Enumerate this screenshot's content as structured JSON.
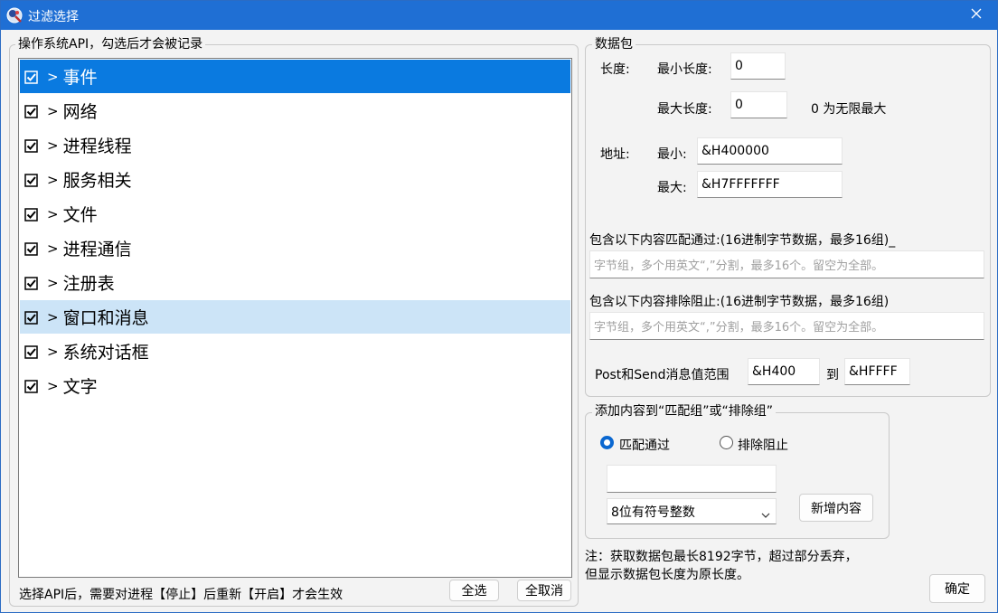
{
  "window": {
    "title": "过滤选择",
    "close_glyph": "✕"
  },
  "api_group": {
    "legend": "操作系统API，勾选后才会被记录",
    "items": [
      {
        "label": "事件",
        "checked": true,
        "state": "selected"
      },
      {
        "label": "网络",
        "checked": true,
        "state": "normal"
      },
      {
        "label": "进程线程",
        "checked": true,
        "state": "normal"
      },
      {
        "label": "服务相关",
        "checked": true,
        "state": "normal"
      },
      {
        "label": "文件",
        "checked": true,
        "state": "normal"
      },
      {
        "label": "进程通信",
        "checked": true,
        "state": "normal"
      },
      {
        "label": "注册表",
        "checked": true,
        "state": "normal"
      },
      {
        "label": "窗口和消息",
        "checked": true,
        "state": "hovered"
      },
      {
        "label": "系统对话框",
        "checked": true,
        "state": "normal"
      },
      {
        "label": "文字",
        "checked": true,
        "state": "normal"
      }
    ],
    "hint": "选择API后，需要对进程【停止】后重新【开启】才会生效",
    "select_all_label": "全选",
    "deselect_all_label": "全取消"
  },
  "packet_group": {
    "legend": "数据包",
    "length_label": "长度:",
    "min_length_label": "最小长度:",
    "min_length_value": "0",
    "max_length_label": "最大长度:",
    "max_length_value": "0",
    "max_length_note": "0 为无限最大",
    "address_label": "地址:",
    "min_addr_label": "最小:",
    "min_addr_value": "&H400000",
    "max_addr_label": "最大:",
    "max_addr_value": "&H7FFFFFFF",
    "include_label": "包含以下内容匹配通过:(16进制字节数据，最多16组)_",
    "include_placeholder": "字节组，多个用英文“,”分割，最多16个。留空为全部。",
    "exclude_label": "包含以下内容排除阻止:(16进制字节数据，最多16组)",
    "exclude_placeholder": "字节组，多个用英文“,”分割，最多16个。留空为全部。",
    "msg_range_label": "Post和Send消息值范围",
    "msg_from_value": "&H400",
    "msg_to_label": "到",
    "msg_to_value": "&HFFFF"
  },
  "add_group": {
    "legend": "添加内容到“匹配组”或“排除组”",
    "radio_match_label": "匹配通过",
    "radio_exclude_label": "排除阻止",
    "selected_radio": "match",
    "content_value": "",
    "type_selected": "8位有符号整数",
    "add_button_label": "新增内容"
  },
  "note_line1": "注：获取数据包最长8192字节，超过部分丢弃，",
  "note_line2": "但显示数据包长度为原长度。",
  "ok_button_label": "确定",
  "colors": {
    "titlebar": "#1f6fd4",
    "selection": "#0a7ae0",
    "hover": "#cce4f7"
  }
}
